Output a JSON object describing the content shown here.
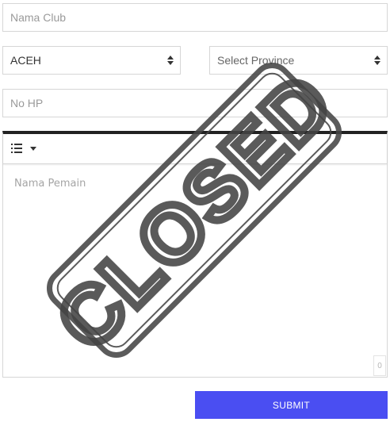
{
  "form": {
    "club_placeholder": "Nama Club",
    "province_value": "ACEH",
    "province2_placeholder": "Select Province",
    "phone_placeholder": "No HP",
    "players_placeholder": "Nama Pemain",
    "char_count": "0",
    "submit_label": "SUBMIT"
  },
  "stamp": {
    "text": "CLOSED"
  },
  "colors": {
    "accent": "#4a4ef2",
    "editor_top_border": "#222222",
    "stamp": "#444444"
  },
  "icons": {
    "list_button": "ordered-list-icon",
    "dropdown": "caret-down-icon",
    "select_arrows": "sort-arrows-icon"
  }
}
